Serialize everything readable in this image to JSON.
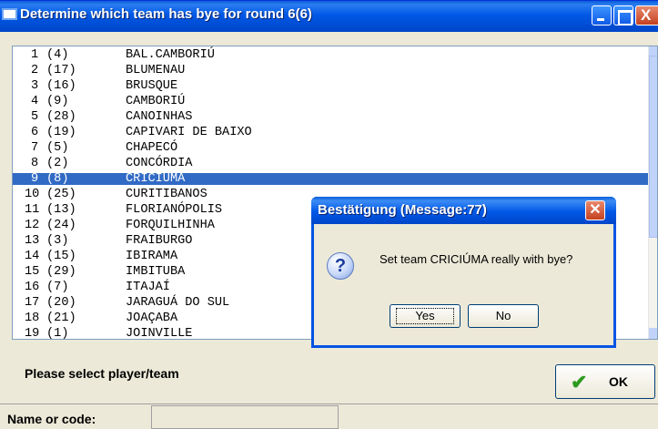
{
  "window": {
    "title": "Determine which team has bye for round 6(6)"
  },
  "list": {
    "selected_index": 8,
    "rows": [
      {
        "num": "1",
        "code": "(4)",
        "name": "BAL.CAMBORIÚ"
      },
      {
        "num": "2",
        "code": "(17)",
        "name": "BLUMENAU"
      },
      {
        "num": "3",
        "code": "(16)",
        "name": "BRUSQUE"
      },
      {
        "num": "4",
        "code": "(9)",
        "name": "CAMBORIÚ"
      },
      {
        "num": "5",
        "code": "(28)",
        "name": "CANOINHAS"
      },
      {
        "num": "6",
        "code": "(19)",
        "name": "CAPIVARI DE BAIXO"
      },
      {
        "num": "7",
        "code": "(5)",
        "name": "CHAPECÓ"
      },
      {
        "num": "8",
        "code": "(2)",
        "name": "CONCÓRDIA"
      },
      {
        "num": "9",
        "code": "(8)",
        "name": "CRICIÚMA"
      },
      {
        "num": "10",
        "code": "(25)",
        "name": "CURITIBANOS"
      },
      {
        "num": "11",
        "code": "(13)",
        "name": "FLORIANÓPOLIS"
      },
      {
        "num": "12",
        "code": "(24)",
        "name": "FORQUILHINHA"
      },
      {
        "num": "13",
        "code": "(3)",
        "name": "FRAIBURGO"
      },
      {
        "num": "14",
        "code": "(15)",
        "name": "IBIRAMA"
      },
      {
        "num": "15",
        "code": "(29)",
        "name": "IMBITUBA"
      },
      {
        "num": "16",
        "code": "(7)",
        "name": "ITAJAÍ"
      },
      {
        "num": "17",
        "code": "(20)",
        "name": "JARAGUÁ DO SUL"
      },
      {
        "num": "18",
        "code": "(21)",
        "name": "JOAÇABA"
      },
      {
        "num": "19",
        "code": "(1)",
        "name": "JOINVILLE"
      }
    ]
  },
  "bottom": {
    "prompt": "Please select player/team",
    "ok_label": "OK",
    "name_label": "Name or code:",
    "name_value": ""
  },
  "dialog": {
    "title": "Bestätigung (Message:77)",
    "message": "Set team CRICIÚMA really with bye?",
    "yes_label": "Yes",
    "no_label": "No"
  },
  "icons": {
    "window": "window-icon",
    "question": "question-icon",
    "ok": "checkmark-icon"
  },
  "colors": {
    "titlebar": "#0058e6",
    "selection": "#316ac5",
    "ok_check": "#2c9a1e"
  }
}
